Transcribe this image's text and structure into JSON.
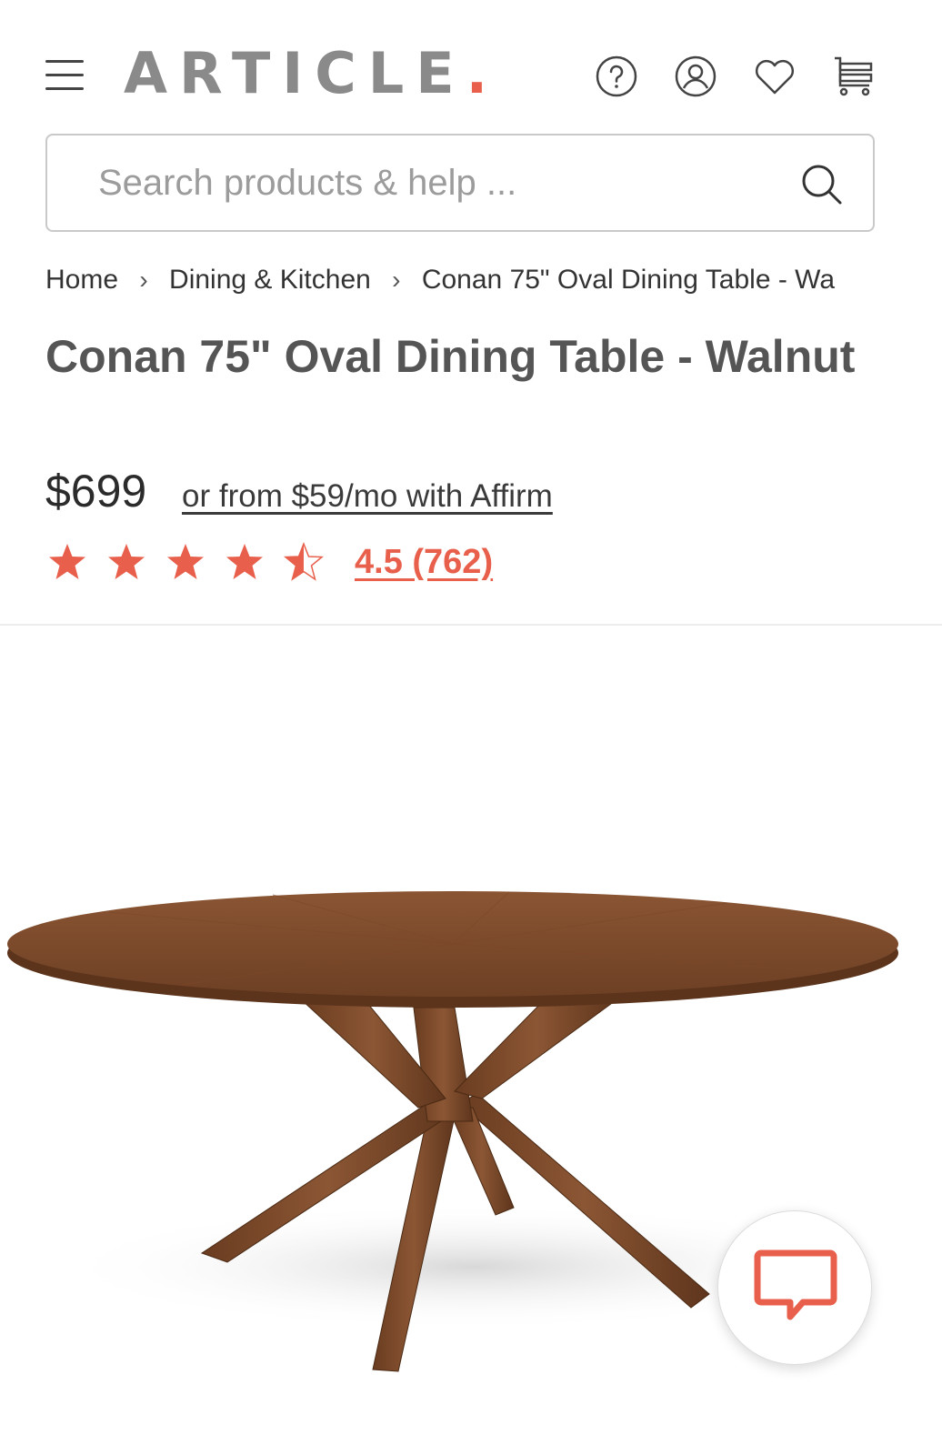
{
  "header": {
    "logo_text": "ARTICLE",
    "logo_dot": ".",
    "icons": [
      "menu-icon",
      "help-icon",
      "account-icon",
      "heart-icon",
      "cart-icon"
    ]
  },
  "search": {
    "placeholder": "Search products & help ...",
    "value": ""
  },
  "breadcrumb": {
    "items": [
      "Home",
      "Dining & Kitchen",
      "Conan 75\" Oval Dining Table - Wa"
    ]
  },
  "product": {
    "title": "Conan 75\" Oval Dining Table - Walnut",
    "price": "$699",
    "financing": "or from $59/mo with Affirm",
    "rating_text": "4.5 (762)",
    "rating_value": 4.5,
    "rating_max": 5
  },
  "colors": {
    "accent": "#e8604c",
    "logo_gray": "#8a8a8a",
    "wood": "#7a4a2b"
  }
}
